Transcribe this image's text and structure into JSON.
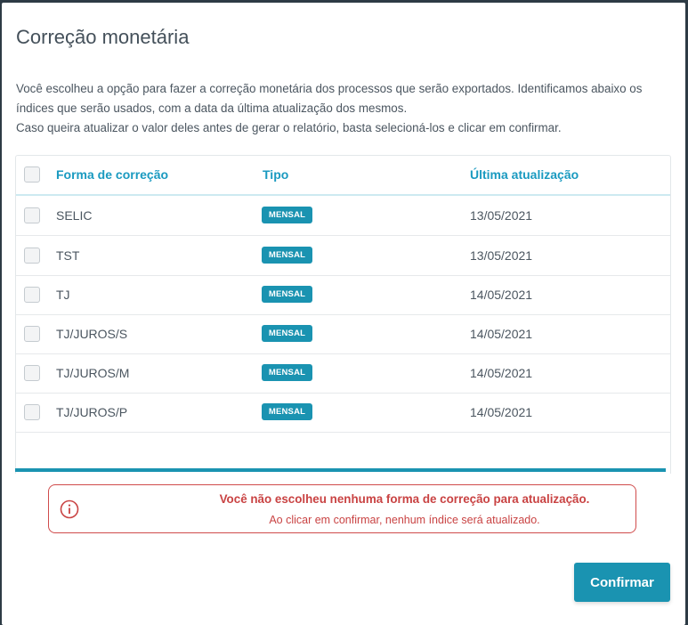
{
  "modal": {
    "title": "Correção monetária",
    "description": [
      "Você escolheu a opção para fazer a correção monetária dos processos que serão exportados. Identificamos abaixo os índices que serão usados, com a data da última atualização dos mesmos.",
      "Caso queira atualizar o valor deles antes de gerar o relatório, basta selecioná-los e clicar em confirmar."
    ]
  },
  "table": {
    "headers": {
      "name": "Forma de correção",
      "type": "Tipo",
      "updated": "Última atualização"
    },
    "rows": [
      {
        "name": "SELIC",
        "type": "MENSAL",
        "date": "13/05/2021",
        "checked": false
      },
      {
        "name": "TST",
        "type": "MENSAL",
        "date": "13/05/2021",
        "checked": false
      },
      {
        "name": "TJ",
        "type": "MENSAL",
        "date": "14/05/2021",
        "checked": false
      },
      {
        "name": "TJ/JUROS/S",
        "type": "MENSAL",
        "date": "14/05/2021",
        "checked": false
      },
      {
        "name": "TJ/JUROS/M",
        "type": "MENSAL",
        "date": "14/05/2021",
        "checked": false
      },
      {
        "name": "TJ/JUROS/P",
        "type": "MENSAL",
        "date": "14/05/2021",
        "checked": false
      }
    ]
  },
  "alert": {
    "icon": "info-circle-icon",
    "title": "Você não escolheu nenhuma forma de correção para atualização.",
    "message": "Ao clicar em confirmar, nenhum índice será atualizado.",
    "color": "#c94343"
  },
  "actions": {
    "confirm_label": "Confirmar"
  },
  "colors": {
    "accent": "#1a93b1",
    "header_text": "#1a9ac0",
    "error": "#c94343"
  }
}
